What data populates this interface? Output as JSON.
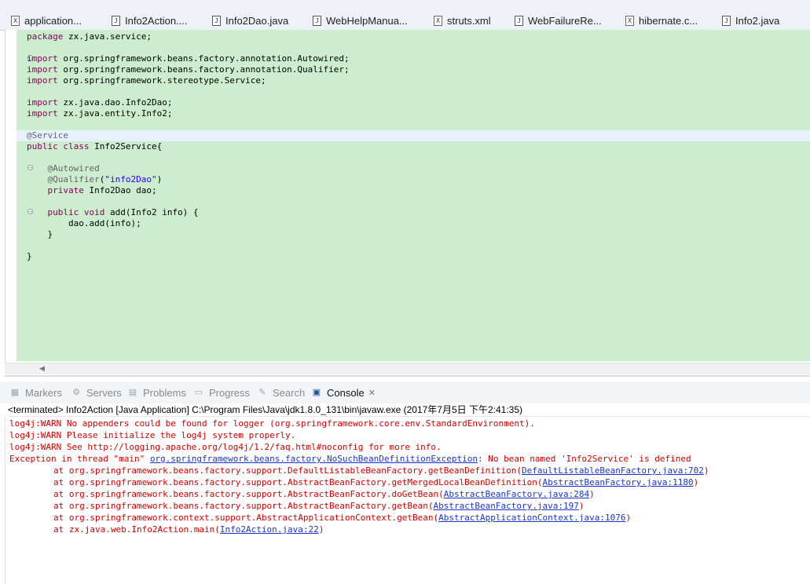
{
  "editor_tabs": [
    {
      "label": "application...",
      "icon": "xml-file-icon"
    },
    {
      "label": "Info2Action....",
      "icon": "java-file-icon"
    },
    {
      "label": "Info2Dao.java",
      "icon": "java-file-icon"
    },
    {
      "label": "WebHelpManua...",
      "icon": "java-file-icon"
    },
    {
      "label": "struts.xml",
      "icon": "xml-file-icon"
    },
    {
      "label": "WebFailureRe...",
      "icon": "java-file-icon"
    },
    {
      "label": "hibernate.c...",
      "icon": "xml-file-icon"
    },
    {
      "label": "Info2.java",
      "icon": "java-file-icon"
    }
  ],
  "code": {
    "l1_kw": "package",
    "l1_rest": " zx.java.service;",
    "l3_kw": "import",
    "l3_rest": " org.springframework.beans.factory.annotation.Autowired;",
    "l4_kw": "import",
    "l4_rest": " org.springframework.beans.factory.annotation.Qualifier;",
    "l5_kw": "import",
    "l5_rest": " org.springframework.stereotype.Service;",
    "l7_kw": "import",
    "l7_rest": " zx.java.dao.Info2Dao;",
    "l8_kw": "import",
    "l8_rest": " zx.java.entity.Info2;",
    "l10_ann": "@Service",
    "l11_kw": "public class",
    "l11_rest": " Info2Service{",
    "l13_ann": "    @Autowired",
    "l14_ann": "    @Qualifier",
    "l14_open": "(",
    "l14_str": "\"info2Dao\"",
    "l14_close": ")",
    "l15_kw": "    private",
    "l15_rest": " Info2Dao dao;",
    "l17_kw": "    public void",
    "l17_rest": " add(Info2 info) {",
    "l18": "        dao.add(info);",
    "l19": "    }",
    "l21": "}"
  },
  "panel_tabs": [
    {
      "label": "Markers",
      "icon": "markers-icon",
      "active": false
    },
    {
      "label": "Servers",
      "icon": "servers-icon",
      "active": false
    },
    {
      "label": "Problems",
      "icon": "problems-icon",
      "active": false
    },
    {
      "label": "Progress",
      "icon": "progress-icon",
      "active": false
    },
    {
      "label": "Search",
      "icon": "search-icon",
      "active": false
    },
    {
      "label": "Console",
      "icon": "console-icon",
      "active": true,
      "close": "✕"
    }
  ],
  "console": {
    "header": "<terminated> Info2Action [Java Application] C:\\Program Files\\Java\\jdk1.8.0_131\\bin\\javaw.exe (2017年7月5日 下午2:41:35)",
    "warn1": "log4j:WARN No appenders could be found for logger (org.springframework.core.env.StandardEnvironment).",
    "warn2": "log4j:WARN Please initialize the log4j system properly.",
    "warn3": "log4j:WARN See http://logging.apache.org/log4j/1.2/faq.html#noconfig for more info.",
    "exc_prefix": "Exception in thread \"main\" ",
    "exc_link": "org.springframework.beans.factory.NoSuchBeanDefinitionException",
    "exc_suffix": ": No bean named 'Info2Service' is defined",
    "stack": [
      {
        "text": "\tat org.springframework.beans.factory.support.DefaultListableBeanFactory.getBeanDefinition(",
        "link": "DefaultListableBeanFactory.java:702",
        "end": ")"
      },
      {
        "text": "\tat org.springframework.beans.factory.support.AbstractBeanFactory.getMergedLocalBeanDefinition(",
        "link": "AbstractBeanFactory.java:1180",
        "end": ")"
      },
      {
        "text": "\tat org.springframework.beans.factory.support.AbstractBeanFactory.doGetBean(",
        "link": "AbstractBeanFactory.java:284",
        "end": ")"
      },
      {
        "text": "\tat org.springframework.beans.factory.support.AbstractBeanFactory.getBean(",
        "link": "AbstractBeanFactory.java:197",
        "end": ")"
      },
      {
        "text": "\tat org.springframework.context.support.AbstractApplicationContext.getBean(",
        "link": "AbstractApplicationContext.java:1076",
        "end": ")"
      },
      {
        "text": "\tat zx.java.web.Info2Action.main(",
        "link": "Info2Action.java:22",
        "end": ")"
      }
    ]
  },
  "colors": {
    "editor_bg": "#cdeece",
    "keyword": "#7f0055",
    "annotation": "#646464",
    "string": "#2a00ff",
    "error_text": "#d10000",
    "link": "#1a35c9"
  }
}
